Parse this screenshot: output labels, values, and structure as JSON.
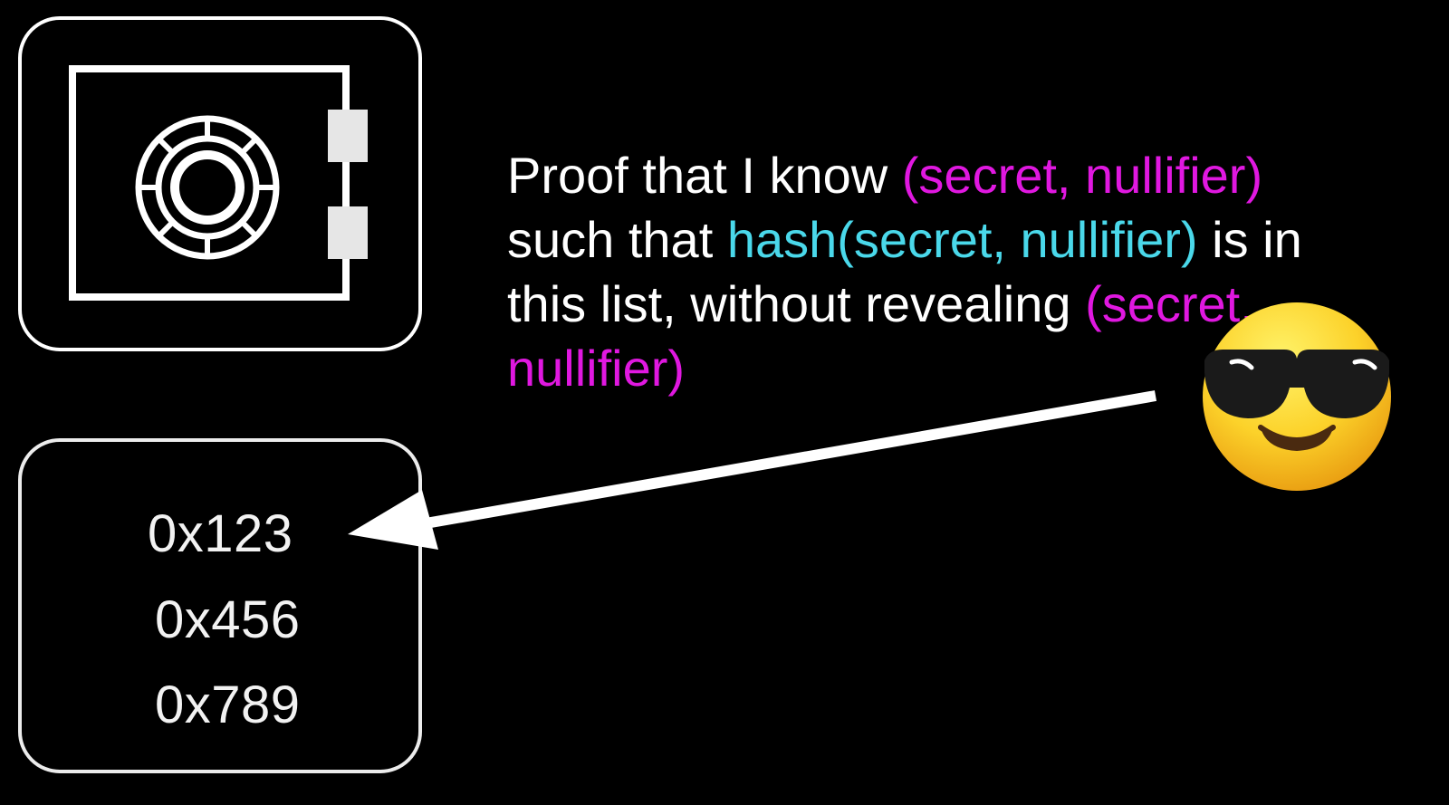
{
  "diagram": {
    "safe": {
      "icon": "safe-icon"
    },
    "commitment_list": {
      "items": [
        "0x123",
        "0x456",
        "0x789"
      ]
    },
    "proof_statement": {
      "part1": "Proof that I know ",
      "secret_pair_1": "(secret, nullifier)",
      "part2": " such that ",
      "hash_expr": "hash(secret, nullifier)",
      "part3": " is in this list, without revealing ",
      "secret_pair_2": "(secret, nullifier)"
    },
    "actor": {
      "icon": "sunglasses-emoji-icon"
    },
    "colors": {
      "background": "#000000",
      "secret_highlight": "#e018e0",
      "hash_highlight": "#4ad8ea",
      "foreground": "#ffffff"
    }
  }
}
